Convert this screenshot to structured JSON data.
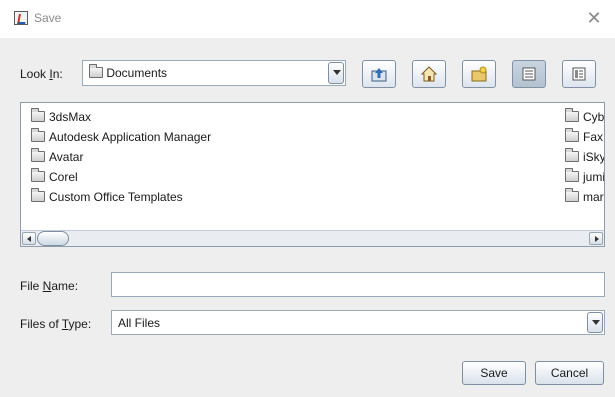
{
  "window": {
    "title": "Save"
  },
  "look_in": {
    "label_pre": "Look ",
    "label_mnemonic": "I",
    "label_post": "n:",
    "selected": "Documents"
  },
  "toolbar": {
    "buttons": [
      "up-one-level",
      "home",
      "new-folder",
      "list-view",
      "details-view"
    ]
  },
  "files": {
    "left_column": [
      "3dsMax",
      "Autodesk Application Manager",
      "Avatar",
      "Corel",
      "Custom Office Templates"
    ],
    "right_column": [
      "Cybe",
      "Fax",
      "iSky",
      "jumi",
      "mary"
    ]
  },
  "file_name": {
    "label_pre": "File ",
    "label_mnemonic": "N",
    "label_post": "ame:",
    "value": ""
  },
  "file_type": {
    "label_pre": "Files of ",
    "label_mnemonic": "T",
    "label_post": "ype:",
    "selected": "All Files"
  },
  "actions": {
    "save": "Save",
    "cancel": "Cancel"
  }
}
